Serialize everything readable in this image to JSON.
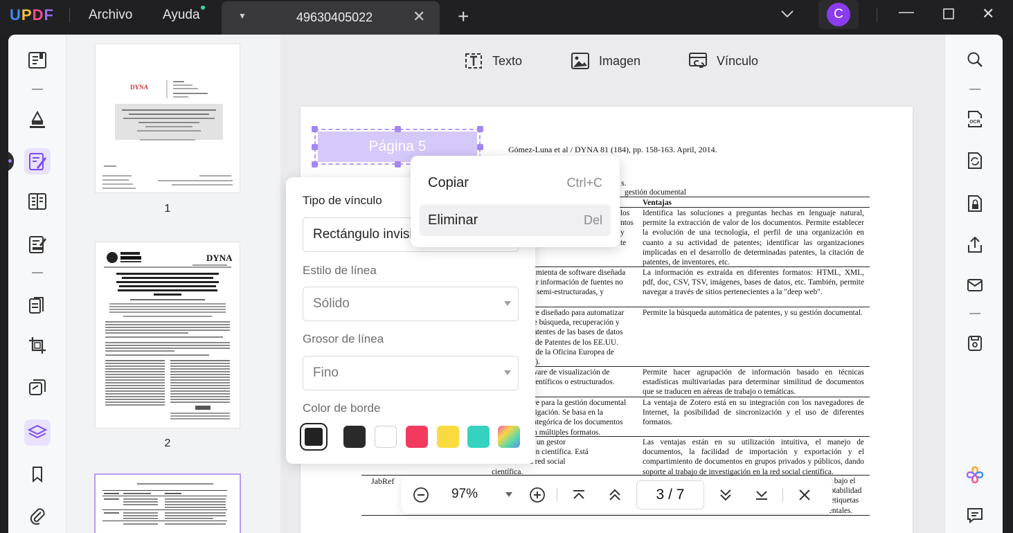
{
  "app": {
    "logo": "UPDF",
    "menu": [
      "Archivo",
      "Ayuda"
    ],
    "tab_title": "49630405022",
    "avatar_initial": "C",
    "accent_color": "#8b3cf1"
  },
  "toolbar": {
    "text_label": "Texto",
    "image_label": "Imagen",
    "link_label": "Vínculo"
  },
  "thumbnails": [
    {
      "label": "1"
    },
    {
      "label": "2"
    }
  ],
  "link_annotation": {
    "label": "Página 5"
  },
  "context_menu": {
    "items": [
      {
        "label": "Copiar",
        "shortcut": "Ctrl+C"
      },
      {
        "label": "Eliminar",
        "shortcut": "Del"
      }
    ]
  },
  "properties": {
    "link_type_label": "Tipo de vínculo",
    "link_type_value": "Rectángulo invisible",
    "line_style_label": "Estilo de línea",
    "line_style_value": "Sólido",
    "line_width_label": "Grosor de línea",
    "line_width_value": "Fino",
    "border_color_label": "Color de borde",
    "swatches": [
      "#222222",
      "#2a2a2a",
      "#ffffff",
      "#f23a5e",
      "#fadb3f",
      "#35d2bf",
      "gradient"
    ]
  },
  "document": {
    "journal_line": "Gómez-Luna et al / DYNA 81 (184), pp. 158-163. April, 2014.",
    "fragment_a": "s.",
    "fragment_b": "gestión documental",
    "column_header": "Ventajas",
    "left_cells": [
      "los\nntos\ny\nte",
      "ramienta de software diseñada\nrar información de fuentes no\ns, semi-estructuradas, y",
      "are diseñado para automatizar\nde búsqueda, recuperación y\npatentes de las bases de datos\na de Patentes de los EE.UU.\ny de la Oficina Europea de\nO).",
      "tware de visualización de\ncientíficos o estructurados.",
      "are para la gestión documental\nstigación. Se basa en la\ncategórica de los documentos\nen múltiples formatos.",
      "que Zotero es un gestor\nde información científica. Está\nado a ser una red social\ncientífica."
    ],
    "right_cells": [
      "Identifica las soluciones a preguntas hechas en lenguaje natural, permite la extracción de valor de los documentos. Permite establecer la evolución de una tecnología, el perfil de una organización en cuanto a su actividad de patentes; identificar las organizaciones implicadas en el desarrollo de determinadas patentes, la citación de patentes, de inventores, etc.",
      "La información es extraída en diferentes formatos: HTML, XML, pdf, doc, CSV, TSV, imágenes, bases de datos, etc. También, permite navegar a través de sitios pertenecientes a la \"deep web\".",
      "Permite la búsqueda automática de patentes, y su gestión documental.",
      "Permite hacer agrupación de información basado en técnicas estadísticas multivariadas para determinar similitud de documentos que se traducen en aéreas de trabajo o temáticas.",
      "La ventaja de Zotero está en su integración con los navegadores de Internet, la posibilidad de sincronización y el uso de diferentes formatos.",
      "Las ventajas están en su utilización intuitiva, el manejo de documentos, la facilidad de importación y exportación y el compartimiento de documentos en grupos privados y públicos, dando soporte al trabajo de investigación en la red social científica.",
      "era bajo el\ndaptabilidad\nar etiquetas\nmentales."
    ],
    "last_row_name": "JabRef"
  },
  "bottom_bar": {
    "zoom": "97%",
    "page_current": "3",
    "page_sep": "/",
    "page_total": "7"
  }
}
